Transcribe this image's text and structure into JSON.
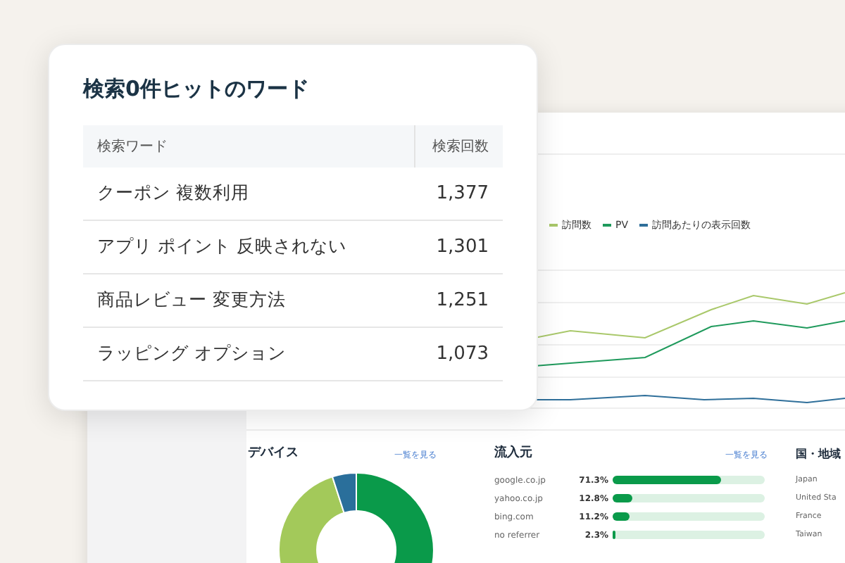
{
  "card": {
    "title": "検索0件ヒットのワード",
    "columns": [
      "検索ワード",
      "検索回数"
    ],
    "rows": [
      {
        "word": "クーポン 複数利用",
        "count": "1,377"
      },
      {
        "word": "アプリ ポイント 反映されない",
        "count": "1,301"
      },
      {
        "word": "商品レビュー 変更方法",
        "count": "1,251"
      },
      {
        "word": "ラッピング オプション",
        "count": "1,073"
      }
    ]
  },
  "dashboard": {
    "legend": [
      {
        "label": "訪問数",
        "color": "#a9c86a"
      },
      {
        "label": "PV",
        "color": "#1f9a5c"
      },
      {
        "label": "訪問あたりの表示回数",
        "color": "#2f6f9a"
      }
    ],
    "devices": {
      "title": "デバイス",
      "link": "一覧を見る"
    },
    "sources": {
      "title": "流入元",
      "link": "一覧を見る",
      "rows": [
        {
          "label": "google.co.jp",
          "reading": "71.3%",
          "level": 0.713
        },
        {
          "label": "yahoo.co.jp",
          "reading": "12.8%",
          "level": 0.128
        },
        {
          "label": "bing.com",
          "reading": "11.2%",
          "level": 0.112
        },
        {
          "label": "no referrer",
          "reading": "2.3%",
          "level": 0.023
        }
      ]
    },
    "countries": {
      "title": "国・地域",
      "rows": [
        {
          "label": "Japan"
        },
        {
          "label": "United Sta"
        },
        {
          "label": "France"
        },
        {
          "label": "Taiwan"
        }
      ]
    }
  }
}
